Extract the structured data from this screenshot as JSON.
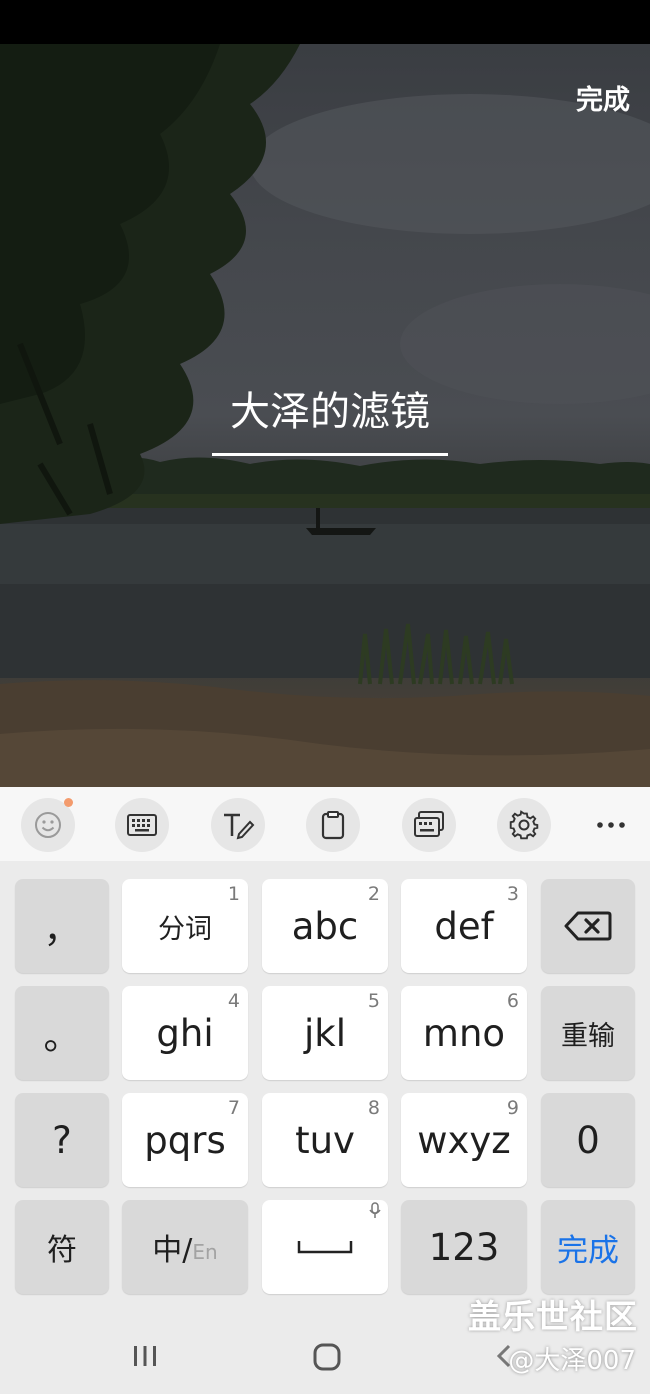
{
  "header": {
    "done_label": "完成"
  },
  "editor": {
    "text_value": "大泽的滤镜"
  },
  "toolbar": {
    "items": [
      {
        "icon": "emoji-icon"
      },
      {
        "icon": "keyboard-icon"
      },
      {
        "icon": "handwriting-icon"
      },
      {
        "icon": "clipboard-icon"
      },
      {
        "icon": "keyboard-layout-icon"
      },
      {
        "icon": "gear-icon"
      },
      {
        "icon": "more-icon"
      }
    ]
  },
  "keyboard": {
    "comma": "，",
    "period": "。",
    "question": "?",
    "symbols": "符",
    "k1": {
      "label": "分词",
      "num": "1"
    },
    "k2": {
      "label": "abc",
      "num": "2"
    },
    "k3": {
      "label": "def",
      "num": "3"
    },
    "k4": {
      "label": "ghi",
      "num": "4"
    },
    "k5": {
      "label": "jkl",
      "num": "5"
    },
    "k6": {
      "label": "mno",
      "num": "6"
    },
    "k7": {
      "label": "pqrs",
      "num": "7"
    },
    "k8": {
      "label": "tuv",
      "num": "8"
    },
    "k9": {
      "label": "wxyz",
      "num": "9"
    },
    "retype": "重输",
    "zero": "0",
    "lang_main": "中/",
    "lang_sub": "En",
    "numbers": "123",
    "done": "完成",
    "done_color": "#1a73e8"
  },
  "watermark": {
    "brand": "盖乐世社区",
    "author": "@大泽007"
  }
}
